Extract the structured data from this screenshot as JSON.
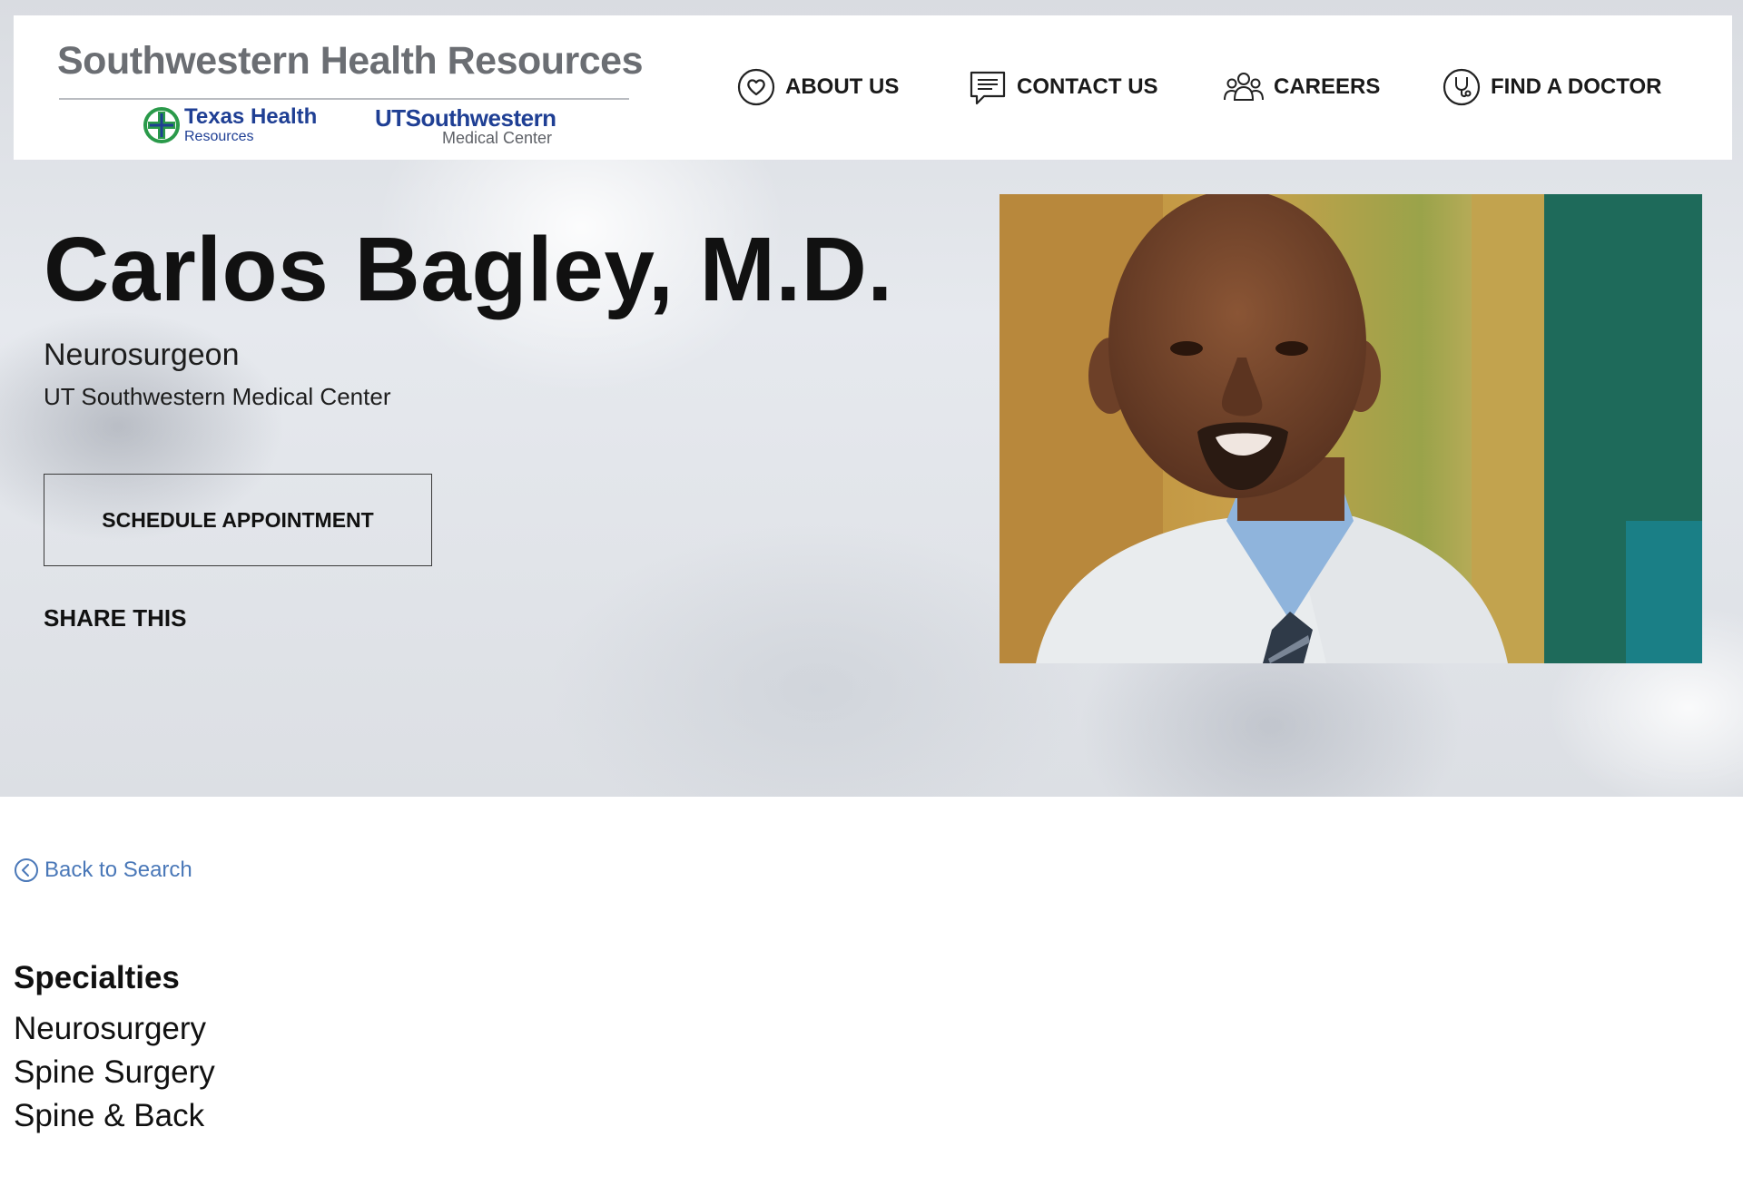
{
  "header": {
    "logo": {
      "title": "Southwestern Health Resources",
      "partner_one_name": "Texas Health",
      "partner_one_sub": "Resources",
      "partner_two_name": "UTSouthwestern",
      "partner_two_sub": "Medical Center"
    },
    "nav": [
      {
        "label": "ABOUT US",
        "icon": "heart-circle-icon"
      },
      {
        "label": "CONTACT US",
        "icon": "chat-bubble-icon"
      },
      {
        "label": "CAREERS",
        "icon": "people-group-icon"
      },
      {
        "label": "FIND A DOCTOR",
        "icon": "stethoscope-circle-icon"
      }
    ]
  },
  "profile": {
    "name": "Carlos Bagley, M.D.",
    "title": "Neurosurgeon",
    "organization": "UT Southwestern Medical Center",
    "schedule_label": "SCHEDULE APPOINTMENT",
    "share_label": "SHARE THIS",
    "photo_icon": "doctor-portrait-photo"
  },
  "back_link": {
    "label": "Back to Search",
    "icon": "chevron-left-circle-icon"
  },
  "specialties": {
    "heading": "Specialties",
    "items": [
      "Neurosurgery",
      "Spine Surgery",
      "Spine & Back"
    ]
  },
  "colors": {
    "brand_blue": "#1f3f94",
    "brand_green": "#2a9a4a",
    "link_blue": "#4a78b8",
    "logo_gray": "#6b6e73"
  }
}
